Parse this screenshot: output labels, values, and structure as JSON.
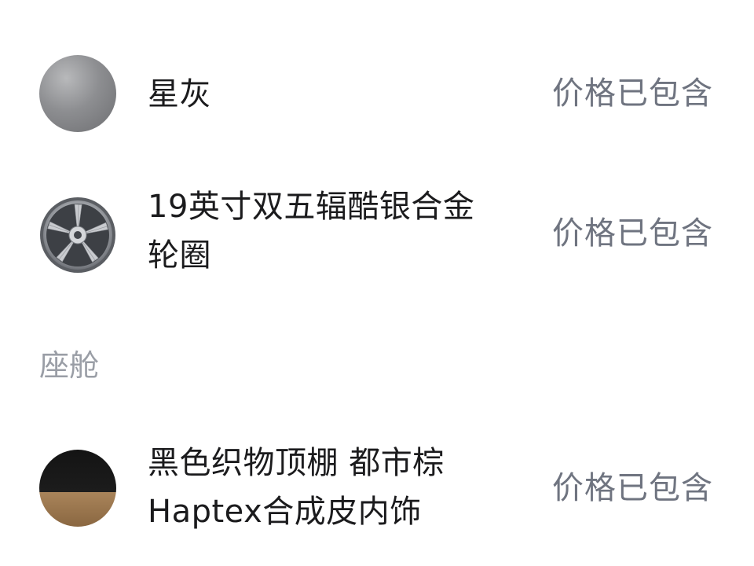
{
  "options": [
    {
      "name": "星灰",
      "price": "价格已包含",
      "icon": "color-swatch-icon"
    },
    {
      "name_line1": "19英寸双五辐酷银合金",
      "name_line2": "轮圈",
      "price": "价格已包含",
      "icon": "wheel-icon"
    }
  ],
  "section": {
    "title": "座舱"
  },
  "cabin_options": [
    {
      "name_line1": "黑色织物顶棚 都市棕",
      "name_line2": "Haptex合成皮内饰",
      "price": "价格已包含",
      "icon": "interior-swatch-icon"
    }
  ],
  "colors": {
    "text_primary": "#1b1b1d",
    "text_secondary": "#6f7480",
    "section_title": "#9a9ea6",
    "paint_gray": "#8d8e91",
    "interior_black": "#141414",
    "interior_brown": "#a9845a"
  }
}
